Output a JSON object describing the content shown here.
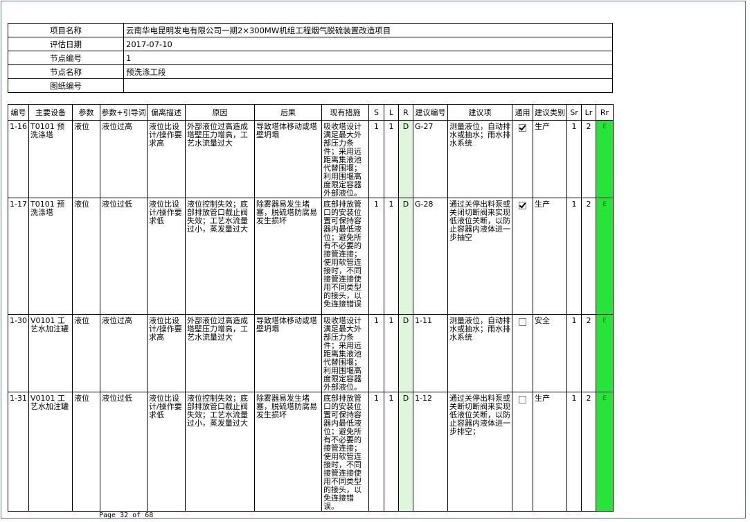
{
  "info": [
    {
      "label": "项目名称",
      "value": "云南华电昆明发电有限公司一期2×300MW机组工程烟气脱硫装置改造项目"
    },
    {
      "label": "评估日期",
      "value": "2017-07-10"
    },
    {
      "label": "节点编号",
      "value": "1"
    },
    {
      "label": "节点名称",
      "value": "预洗涤工段"
    },
    {
      "label": "图纸编号",
      "value": ""
    }
  ],
  "columns": [
    "编号",
    "主要设备",
    "参数",
    "参数+引导词",
    "偏离描述",
    "原因",
    "后果",
    "现有措施",
    "S",
    "L",
    "R",
    "建议编号",
    "建议项",
    "通用",
    "建议类别",
    "Sr",
    "Lr",
    "Rr"
  ],
  "rows": [
    {
      "id": "1-16",
      "equipment": "T0101 预洗涤塔",
      "param": "液位",
      "guide": "液位过高",
      "deviation": "液位比设计/操作要求高",
      "cause": "外部液位过高造成塔壁压力增高，工艺水流量过大",
      "consequence": "导致塔体移动或塔壁坍塌",
      "measures": "吸收塔设计满足最大外部压力条件；采用远距离集液池代替围堰；利用围堰高度限定容器外部液位。",
      "s": "1",
      "l": "1",
      "r": "D",
      "rec_id": "G-27",
      "rec": "测量液位，自动排水或抽水；雨水排水系统",
      "general": true,
      "category": "生产",
      "sr": "1",
      "lr": "2",
      "rr": "E"
    },
    {
      "id": "1-17",
      "equipment": "T0101 预洗涤塔",
      "param": "液位",
      "guide": "液位过低",
      "deviation": "液位比设计/操作要求低",
      "cause": "液位控制失效；底部排放管口截止阀失效；工艺水流量过小，蒸发量过大",
      "consequence": "除雾器易发生堵塞，脱硫塔防腐易发生损坏",
      "measures": "底部排放管口的安装位置可保持容器内最低液位；避免所有不必要的接管连接；使用软管连接时，不同接管连接使用不同类型的接头，以免连接错误",
      "s": "1",
      "l": "1",
      "r": "D",
      "rec_id": "G-28",
      "rec": "通过关停出料泵或关闭切断阀来实现低液位关断，以防止容器内液体进一步抽空",
      "general": true,
      "category": "生产",
      "sr": "1",
      "lr": "2",
      "rr": "E"
    },
    {
      "id": "1-30",
      "equipment": "V0101 工艺水加注罐",
      "param": "液位",
      "guide": "液位过高",
      "deviation": "液位比设计/操作要求高",
      "cause": "外部液位过高造成塔壁压力增高，工艺水流量过大",
      "consequence": "导致塔体移动或塔壁坍塌",
      "measures": "吸收塔设计满足最大外部压力条件；采用远距离集液池代替围堰；利用围堰高度限定容器外部液位。",
      "s": "1",
      "l": "1",
      "r": "D",
      "rec_id": "1-11",
      "rec": "测量液位，自动排水或抽水；雨水排水系统",
      "general": false,
      "category": "安全",
      "sr": "1",
      "lr": "2",
      "rr": "E"
    },
    {
      "id": "1-31",
      "equipment": "V0101 工艺水加注罐",
      "param": "液位",
      "guide": "液位过低",
      "deviation": "液位比设计/操作要求低",
      "cause": "液位控制失效；底部排放管口截止阀失效；工艺水流量过小，蒸发量过大",
      "consequence": "除雾器易发生堵塞，脱硫塔防腐易发生损坏",
      "measures": "底部排放管口的安装位置可保持容器内最低液位；避免所有不必要的接管连接；使用软管连接时，不同接管连接使用不同类型的接头，以免连接错误。",
      "s": "1",
      "l": "1",
      "r": "D",
      "rec_id": "1-12",
      "rec": "通过关停出料泵或关断切断阀来实现低液位关断，以防止容器内液体进一步排空；",
      "general": false,
      "category": "生产",
      "sr": "1",
      "lr": "2",
      "rr": "E"
    }
  ],
  "footer": "Page 32 of 68"
}
